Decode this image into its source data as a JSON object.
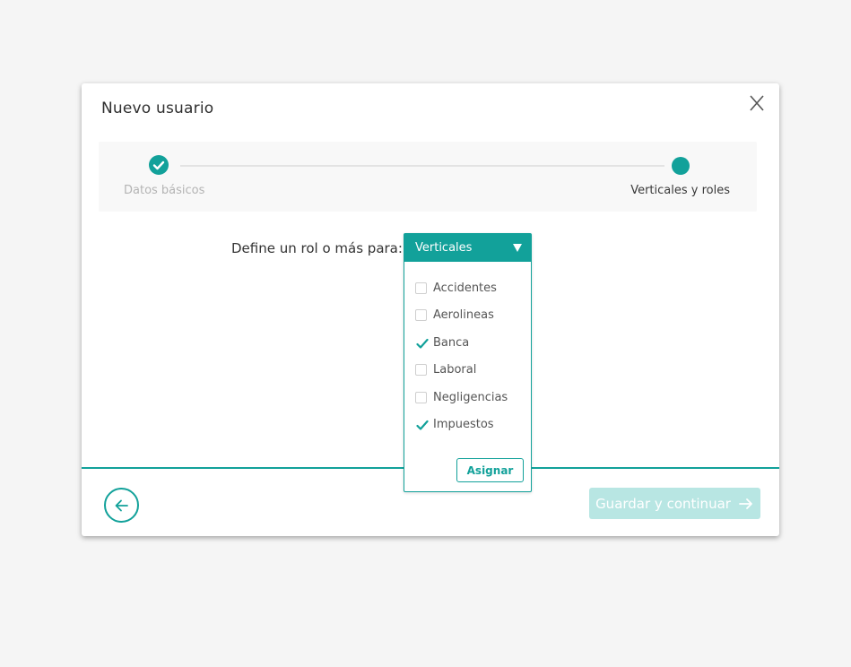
{
  "modal": {
    "title": "Nuevo usuario",
    "close_label": "X"
  },
  "stepper": {
    "steps": [
      {
        "label": "Datos básicos",
        "state": "done"
      },
      {
        "label": "Verticales y roles",
        "state": "current"
      }
    ]
  },
  "form": {
    "role_label": "Define un rol o más para:"
  },
  "dropdown": {
    "selected": "Verticales",
    "options": [
      {
        "label": "Accidentes",
        "checked": false
      },
      {
        "label": "Aerolineas",
        "checked": false
      },
      {
        "label": "Banca",
        "checked": true
      },
      {
        "label": "Laboral",
        "checked": false
      },
      {
        "label": "Negligencias",
        "checked": false
      },
      {
        "label": "Impuestos",
        "checked": true
      }
    ],
    "assign_label": "Asignar"
  },
  "footer": {
    "save_label": "Guardar y continuar"
  },
  "colors": {
    "accent": "#12a19a",
    "accent_disabled": "#b8e6e3"
  }
}
